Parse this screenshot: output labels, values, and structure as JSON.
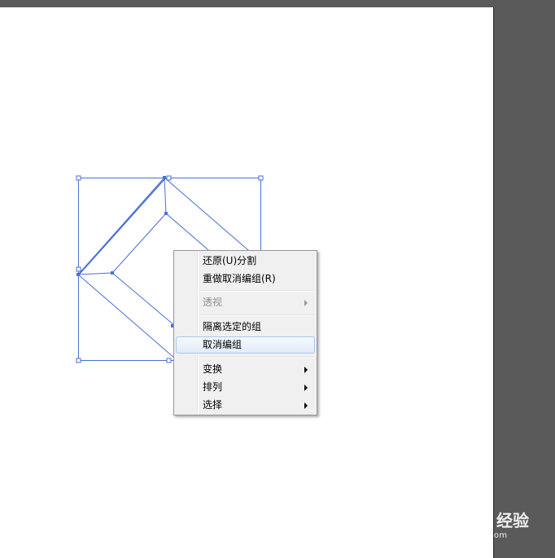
{
  "context_menu": {
    "items": [
      {
        "label": "还原(U)分割",
        "disabled": false,
        "submenu": false
      },
      {
        "label": "重做取消编组(R)",
        "disabled": false,
        "submenu": false
      },
      {
        "label": "透视",
        "disabled": true,
        "submenu": true
      },
      {
        "label": "隔离选定的组",
        "disabled": false,
        "submenu": false
      },
      {
        "label": "取消编组",
        "disabled": false,
        "submenu": false,
        "highlighted": true
      },
      {
        "label": "变换",
        "disabled": false,
        "submenu": true
      },
      {
        "label": "排列",
        "disabled": false,
        "submenu": true
      },
      {
        "label": "选择",
        "disabled": false,
        "submenu": true
      }
    ]
  },
  "watermark": {
    "logo": "Bai",
    "text": "经验",
    "url": "jingyan.baidu.com"
  },
  "colors": {
    "selection": "#4a6fd4",
    "canvas": "#ffffff",
    "workspace": "#5a5a5a",
    "menu_bg": "#f0f0f0",
    "menu_highlight": "#a8c8ec"
  }
}
